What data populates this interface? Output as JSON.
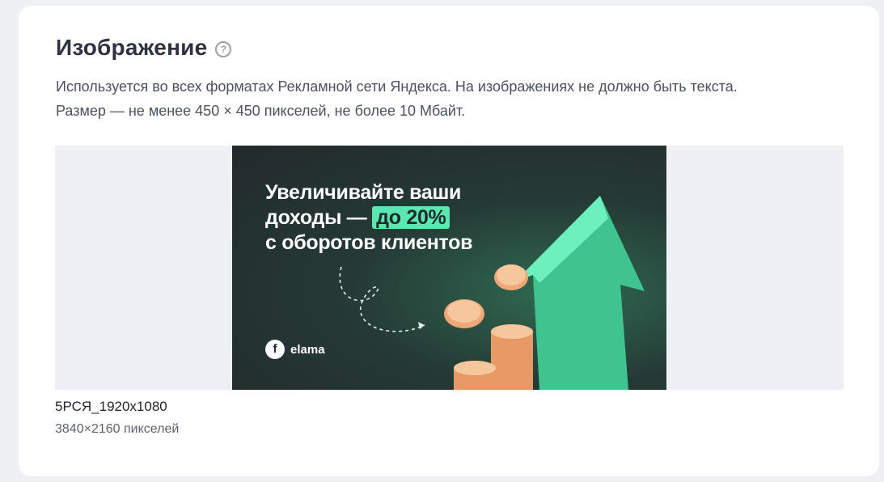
{
  "section": {
    "title": "Изображение",
    "help_icon": "question-circle-icon",
    "description_line1": "Используется во всех форматах Рекламной сети Яндекса. На изображениях не должно быть текста.",
    "description_line2": "Размер — не менее 450 × 450 пикселей, не более 10 Мбайт."
  },
  "banner": {
    "headline_line1": "Увеличивайте ваши",
    "headline_line2_prefix": "доходы — ",
    "headline_line2_highlight": "до 20%",
    "headline_line3": "с оборотов клиентов",
    "brand_logo_glyph": "f",
    "brand_name": "elama",
    "accent_color": "#5be7b0",
    "background_color": "#23292d",
    "coin_color": "#f0a777"
  },
  "file": {
    "name": "5РСЯ_1920x1080",
    "dimensions": "3840×2160 пикселей"
  }
}
